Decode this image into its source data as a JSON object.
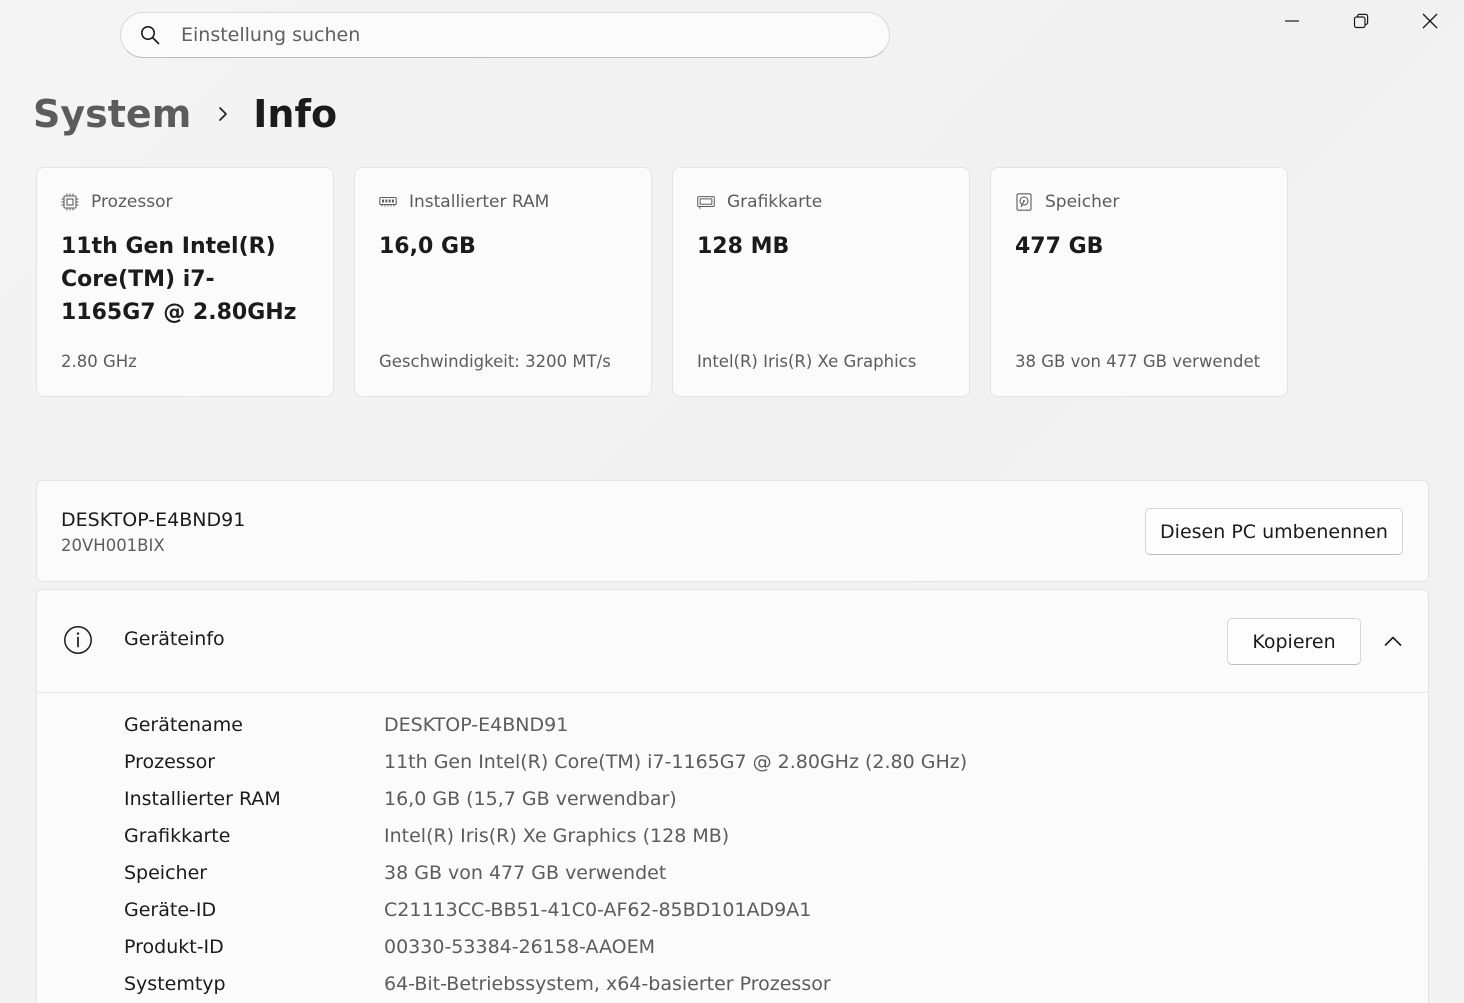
{
  "search": {
    "placeholder": "Einstellung suchen"
  },
  "breadcrumb": {
    "parent": "System",
    "current": "Info"
  },
  "cards": [
    {
      "icon": "processor-icon",
      "label": "Prozessor",
      "value": "11th Gen Intel(R) Core(TM) i7-1165G7 @ 2.80GHz",
      "sub": "2.80 GHz"
    },
    {
      "icon": "ram-icon",
      "label": "Installierter RAM",
      "value": "16,0 GB",
      "sub": "Geschwindigkeit: 3200 MT/s"
    },
    {
      "icon": "graphics-card-icon",
      "label": "Grafikkarte",
      "value": "128 MB",
      "sub": "Intel(R) Iris(R) Xe Graphics"
    },
    {
      "icon": "storage-icon",
      "label": "Speicher",
      "value": "477 GB",
      "sub": "38 GB von 477 GB verwendet"
    }
  ],
  "pc": {
    "name": "DESKTOP-E4BND91",
    "model": "20VH001BIX",
    "rename_label": "Diesen PC umbenennen"
  },
  "device_info": {
    "title": "Geräteinfo",
    "copy_label": "Kopieren",
    "rows": [
      {
        "key": "Gerätename",
        "value": "DESKTOP-E4BND91"
      },
      {
        "key": "Prozessor",
        "value": "11th Gen Intel(R) Core(TM) i7-1165G7 @ 2.80GHz (2.80 GHz)"
      },
      {
        "key": "Installierter RAM",
        "value": "16,0 GB (15,7 GB verwendbar)"
      },
      {
        "key": "Grafikkarte",
        "value": "Intel(R) Iris(R) Xe Graphics (128 MB)"
      },
      {
        "key": "Speicher",
        "value": "38 GB von 477 GB verwendet"
      },
      {
        "key": "Geräte-ID",
        "value": "C21113CC-BB51-41C0-AF62-85BD101AD9A1"
      },
      {
        "key": "Produkt-ID",
        "value": "00330-53384-26158-AAOEM"
      },
      {
        "key": "Systemtyp",
        "value": "64-Bit-Betriebssystem, x64-basierter Prozessor"
      }
    ]
  },
  "colors": {
    "background": "#f3f3f3",
    "card": "#fbfbfb",
    "text_primary": "#1b1b1b",
    "text_secondary": "#5c5c5c"
  }
}
